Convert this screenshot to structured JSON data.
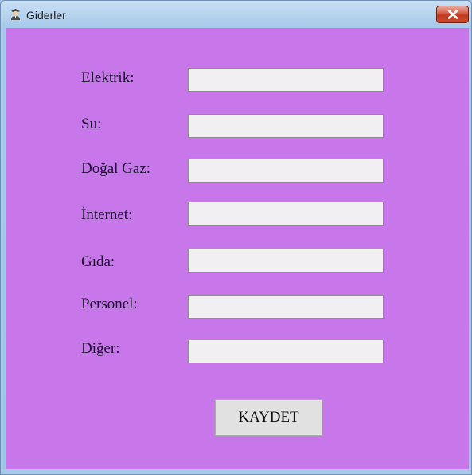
{
  "window": {
    "title": "Giderler",
    "app_icon": "person-icon",
    "close_icon": "close-icon"
  },
  "colors": {
    "client_background": "#c777e9",
    "input_background": "#f1eff2",
    "button_background": "#e2e1e2",
    "close_button": "#c9492c"
  },
  "form": {
    "fields": [
      {
        "label": "Elektrik:",
        "value": ""
      },
      {
        "label": "Su:",
        "value": ""
      },
      {
        "label": "Doğal Gaz:",
        "value": ""
      },
      {
        "label": "İnternet:",
        "value": ""
      },
      {
        "label": "Gıda:",
        "value": ""
      },
      {
        "label": "Personel:",
        "value": ""
      },
      {
        "label": "Diğer:",
        "value": ""
      }
    ],
    "save_label": "KAYDET"
  }
}
